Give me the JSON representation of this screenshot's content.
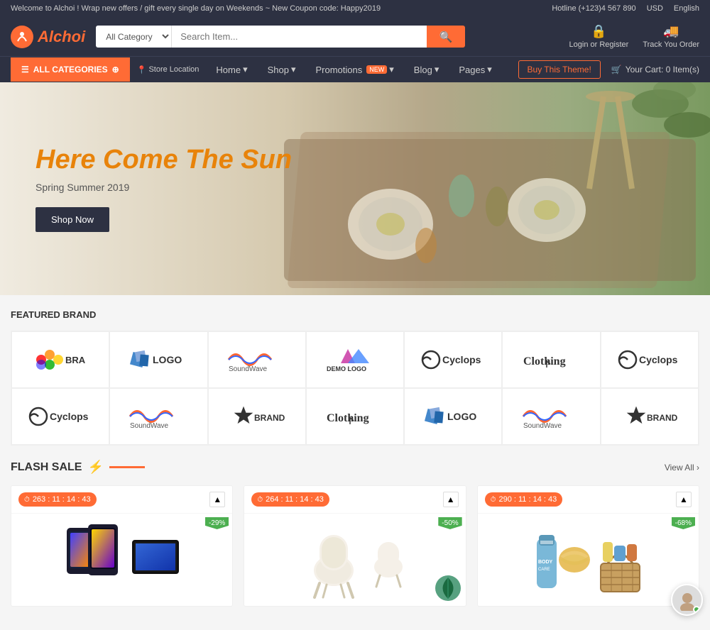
{
  "topbar": {
    "announcement": "Welcome to Alchoi ! Wrap new offers / gift every single day on Weekends ~ New Coupon code: Happy2019",
    "hotline_label": "Hotline (+123)4 567 890",
    "currency": "USD",
    "language": "English"
  },
  "header": {
    "logo_text": "Alchoi",
    "search_category": "All Category",
    "search_placeholder": "Search Item...",
    "login_label": "Login or Register",
    "track_label": "Track You Order"
  },
  "navbar": {
    "all_categories": "ALL CATEGORIES",
    "store_location": "Store Location",
    "menu_items": [
      "Home",
      "Shop",
      "Promotions",
      "Blog",
      "Pages"
    ],
    "promotions_badge": "NEW",
    "buy_theme": "Buy This Theme!",
    "cart_label": "Your Cart:",
    "cart_count": "0 Item(s)"
  },
  "hero": {
    "title": "Here Come The Sun",
    "subtitle": "Spring Summer 2019",
    "cta": "Shop Now"
  },
  "featured_brands": {
    "title": "FEATURED BRAND",
    "brands": [
      {
        "name": "BRAND",
        "type": "apple"
      },
      {
        "name": "LOGO",
        "type": "logo"
      },
      {
        "name": "SoundWave",
        "type": "soundwave"
      },
      {
        "name": "DEMO LOGO",
        "type": "demo"
      },
      {
        "name": "Cyclops",
        "type": "cyclops"
      },
      {
        "name": "Clothing",
        "type": "clothing"
      },
      {
        "name": "Cyclops",
        "type": "cyclops"
      },
      {
        "name": "Cyclops",
        "type": "cyclops"
      },
      {
        "name": "SoundWave",
        "type": "soundwave"
      },
      {
        "name": "BRAND",
        "type": "brand_star"
      },
      {
        "name": "Clothing",
        "type": "clothing"
      },
      {
        "name": "LOGO",
        "type": "logo"
      },
      {
        "name": "SoundWave",
        "type": "soundwave"
      },
      {
        "name": "BRAND",
        "type": "brand_star"
      }
    ]
  },
  "flash_sale": {
    "title": "FLASH SALE",
    "view_all": "View All",
    "products": [
      {
        "countdown": "263 : 11 : 14 : 43",
        "discount": "-29%",
        "type": "electronics"
      },
      {
        "countdown": "264 : 11 : 14 : 43",
        "discount": "-50%",
        "type": "furniture"
      },
      {
        "countdown": "290 : 11 : 14 : 43",
        "discount": "-68%",
        "type": "beauty"
      }
    ]
  }
}
